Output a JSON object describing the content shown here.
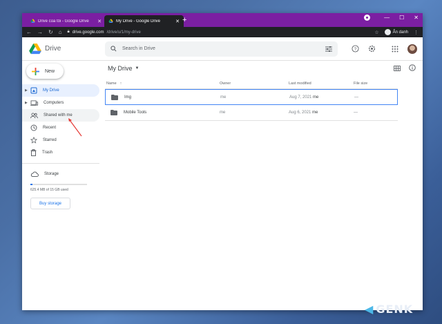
{
  "browser": {
    "tabs": [
      {
        "title": "Drive của tôi - Google Drive",
        "active": false
      },
      {
        "title": "My Drive - Google Drive",
        "active": true
      }
    ],
    "url_host": "drive.google.com",
    "url_path": "/drive/u/1/my-drive",
    "profile_label": "Ẩn danh"
  },
  "drive": {
    "brand": "Drive",
    "search_placeholder": "Search in Drive",
    "new_label": "New",
    "nav": [
      {
        "label": "My Drive"
      },
      {
        "label": "Computers"
      },
      {
        "label": "Shared with me"
      },
      {
        "label": "Recent"
      },
      {
        "label": "Starred"
      },
      {
        "label": "Trash"
      }
    ],
    "storage_label": "Storage",
    "storage_used": "625.4 MB of 15 GB used",
    "storage_fraction": 0.04,
    "buy_storage": "Buy storage",
    "breadcrumb": "My Drive",
    "columns": {
      "name": "Name",
      "owner": "Owner",
      "modified": "Last modified",
      "size": "File size"
    },
    "files": [
      {
        "name": "Img",
        "owner": "me",
        "modified_date": "Aug 7, 2021",
        "modified_by": "me",
        "size": "—"
      },
      {
        "name": "Mobile Tools",
        "owner": "me",
        "modified_date": "Aug 6, 2021",
        "modified_by": "me",
        "size": "—"
      }
    ]
  },
  "watermark": "GENK",
  "colors": {
    "tabbar": "#7b1fa2",
    "accent": "#1a73e8",
    "active_nav_bg": "#e8f0fe"
  }
}
